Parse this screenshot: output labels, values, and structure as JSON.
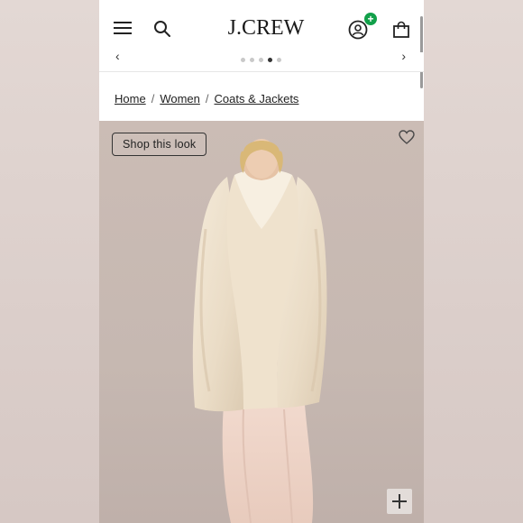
{
  "header": {
    "logo": "J.CREW",
    "account_badge": "+",
    "icons": [
      "menu-icon",
      "search-icon",
      "account-icon",
      "bag-icon"
    ]
  },
  "carousel": {
    "prev": "‹",
    "next": "›",
    "dot_count": 5,
    "active_dot": 4
  },
  "breadcrumb": {
    "items": [
      "Home",
      "Women",
      "Coats & Jackets"
    ],
    "separator": "/"
  },
  "product": {
    "shop_look_label": "Shop this look",
    "favorite_icon": "heart-icon",
    "zoom_icon": "plus-icon"
  },
  "colors": {
    "badge": "#12a04a",
    "backdrop": "#c9bab3",
    "coat": "#efe3cf"
  }
}
